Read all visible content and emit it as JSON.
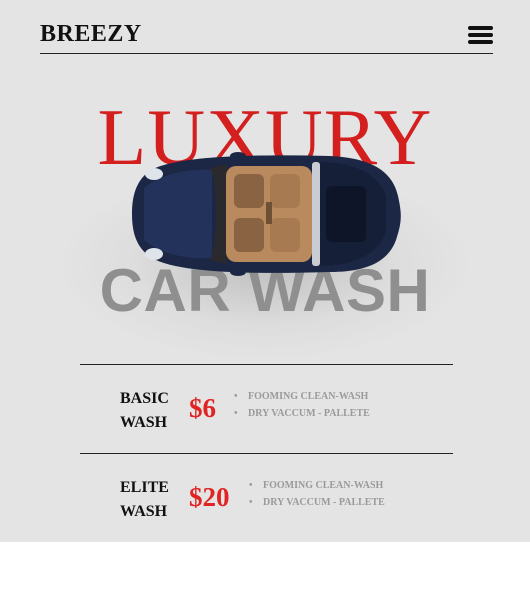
{
  "header": {
    "brand": "BREEZY",
    "menu_icon": "hamburger-menu-icon"
  },
  "hero": {
    "title_top": "LUXURY",
    "title_bottom": "CAR WASH",
    "image": "sports-car-top-view",
    "colors": {
      "title_top": "#d41f1f",
      "title_bottom": "#8f8f8f",
      "car_body": "#1c2745"
    }
  },
  "plans": [
    {
      "name_line1": "BASIC",
      "name_line2": "WASH",
      "price": "$6",
      "features": [
        "FOOMING CLEAN-WASH",
        "DRY VACCUM - PALLETE"
      ]
    },
    {
      "name_line1": "ELITE",
      "name_line2": "WASH",
      "price": "$20",
      "features": [
        "FOOMING CLEAN-WASH",
        "DRY VACCUM - PALLETE"
      ]
    }
  ],
  "theme": {
    "panel_background": "#e4e4e4",
    "price_color": "#e02323",
    "feature_color": "#9a9a9a"
  }
}
